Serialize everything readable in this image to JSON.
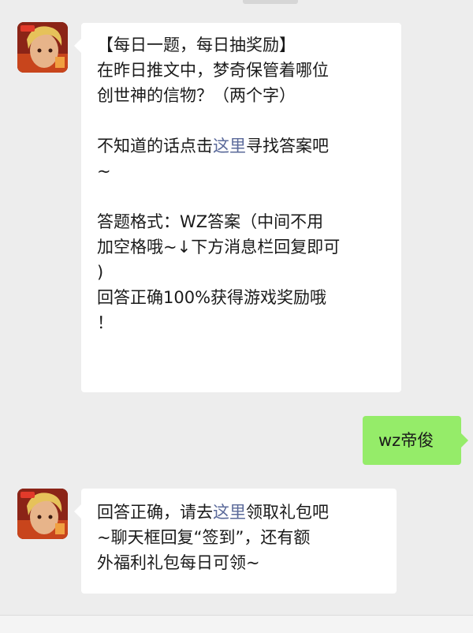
{
  "messages": {
    "m1": {
      "sender": "bot",
      "avatar_icon": "hero-avatar-icon",
      "lines": [
        "【每日一题，每日抽奖励】",
        "在昨日推文中，梦奇保管着哪位",
        "创世神的信物？（两个字）",
        "",
        [
          "不知道的话点击",
          "这里",
          "寻找答案吧"
        ],
        "~",
        "",
        "答题格式：WZ答案（中间不用",
        "加空格哦~↓下方消息栏回复即可",
        ")",
        "回答正确100%获得游戏奖励哦",
        "！"
      ],
      "l1": "【每日一题，每日抽奖励】",
      "l2": "在昨日推文中，梦奇保管着哪位",
      "l3": "创世神的信物？（两个字）",
      "l5_pre": "不知道的话点击",
      "l5_link": "这里",
      "l5_post": "寻找答案吧",
      "l6": "~",
      "l8": "答题格式：WZ答案（中间不用",
      "l9": "加空格哦~↓下方消息栏回复即可",
      "l10": ")",
      "l11": "回答正确100%获得游戏奖励哦",
      "l12": "！"
    },
    "m2": {
      "sender": "user",
      "text": "wz帝俊"
    },
    "m3": {
      "sender": "bot",
      "avatar_icon": "hero-avatar-icon",
      "l1_pre": "回答正确，请去",
      "l1_link": "这里",
      "l1_post": "领取礼包吧",
      "l2": "~聊天框回复“签到”，还有额",
      "l3": "外福利礼包每日可领~"
    }
  },
  "colors": {
    "background": "#ededed",
    "bubble_left": "#ffffff",
    "bubble_right": "#95ec69",
    "link": "#5b6a9a"
  }
}
